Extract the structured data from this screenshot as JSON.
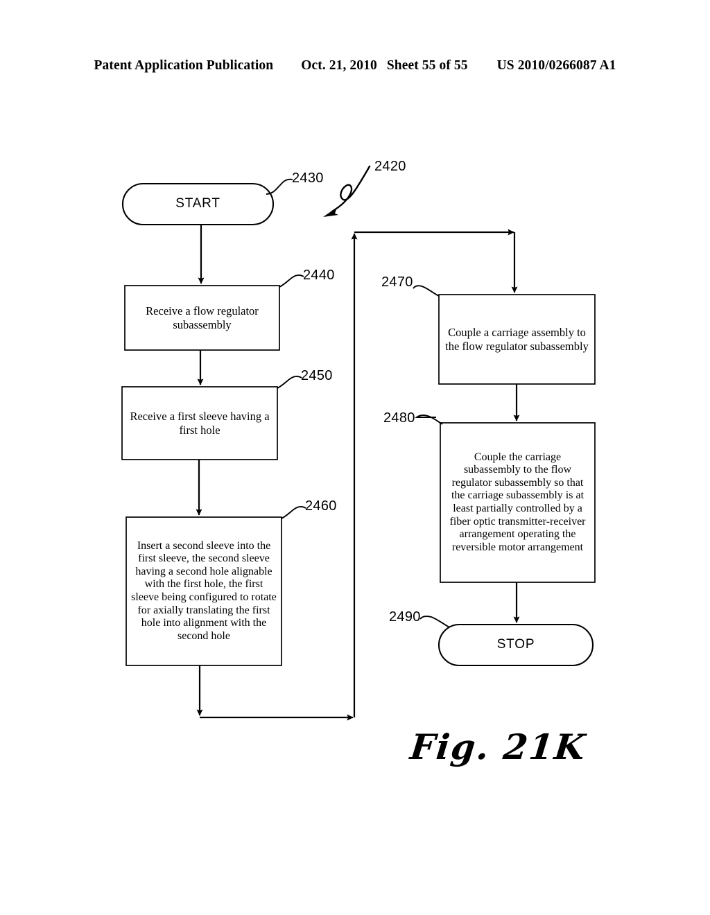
{
  "header": {
    "publication": "Patent Application Publication",
    "date": "Oct. 21, 2010",
    "sheet": "Sheet 55 of 55",
    "patent_number": "US 2010/0266087 A1"
  },
  "figure": {
    "caption": "Fig. 21K",
    "overall_ref": "2420"
  },
  "flowchart": {
    "nodes": [
      {
        "id": "start",
        "ref": "2430",
        "shape": "terminal",
        "label": "START"
      },
      {
        "id": "s2440",
        "ref": "2440",
        "shape": "process",
        "label": "Receive a flow regulator subassembly"
      },
      {
        "id": "s2450",
        "ref": "2450",
        "shape": "process",
        "label": "Receive a first sleeve having a first hole"
      },
      {
        "id": "s2460",
        "ref": "2460",
        "shape": "process",
        "label": "Insert a second sleeve into the first sleeve, the second sleeve having a second hole alignable with the first hole, the first sleeve being configured to rotate for axially translating the first hole into alignment with the second hole"
      },
      {
        "id": "s2470",
        "ref": "2470",
        "shape": "process",
        "label": "Couple a carriage assembly to the flow regulator subassembly"
      },
      {
        "id": "s2480",
        "ref": "2480",
        "shape": "process",
        "label": "Couple the carriage subassembly to the flow regulator subassembly so that the carriage subassembly is at least partially controlled by a fiber optic transmitter-receiver arrangement operating the reversible motor arrangement"
      },
      {
        "id": "stop",
        "ref": "2490",
        "shape": "terminal",
        "label": "STOP"
      }
    ],
    "edges": [
      {
        "from": "start",
        "to": "s2440"
      },
      {
        "from": "s2440",
        "to": "s2450"
      },
      {
        "from": "s2450",
        "to": "s2460"
      },
      {
        "from": "s2460",
        "to": "s2470"
      },
      {
        "from": "s2470",
        "to": "s2480"
      },
      {
        "from": "s2480",
        "to": "stop"
      }
    ],
    "colors": {
      "stroke": "#000000",
      "background": "#ffffff"
    }
  }
}
